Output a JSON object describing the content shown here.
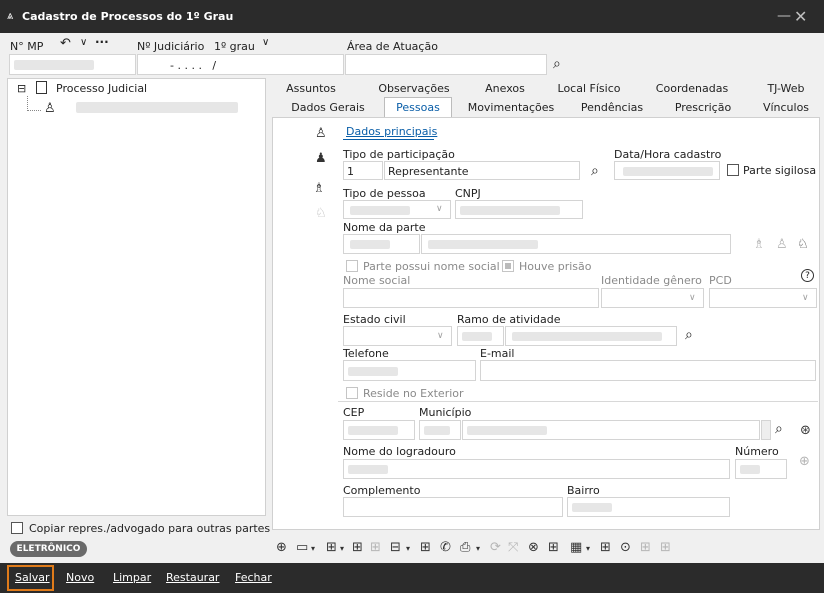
{
  "window": {
    "title": "Cadastro de Processos do 1º Grau",
    "minimize": "—",
    "close": "✕"
  },
  "header": {
    "mp_label": "N° MP",
    "undo_icon": "↶",
    "chevron": "∨",
    "more": "···",
    "judicial_label": "Nº Judiciário",
    "grau_label": "1º grau",
    "area_label": "Área de Atuação",
    "judicial_value": "- . . . .   /"
  },
  "tree": {
    "root": "Processo Judicial",
    "expander": "⊟"
  },
  "copiar": "Copiar repres./advogado para outras partes",
  "badge": "ELETRÔNICO",
  "tabs_row1": [
    "Assuntos",
    "Observações",
    "Anexos",
    "Local Físico",
    "Coordenadas",
    "TJ-Web"
  ],
  "tabs_row2": [
    "Dados Gerais",
    "Pessoas",
    "Movimentações",
    "Pendências",
    "Prescrição",
    "Vínculos"
  ],
  "form": {
    "subtab": "Dados principais",
    "tipo_participacao": "Tipo de participação",
    "tipo_code": "1",
    "tipo_value": "Representante",
    "data_hora": "Data/Hora cadastro",
    "parte_sigilosa": "Parte sigilosa",
    "tipo_pessoa": "Tipo de pessoa",
    "cnpj": "CNPJ",
    "nome_parte": "Nome da parte",
    "nome_social_chk": "Parte possui nome social",
    "houve_prisao": "Houve prisão",
    "nome_social": "Nome social",
    "identidade_genero": "Identidade gênero",
    "pcd": "PCD",
    "estado_civil": "Estado civil",
    "ramo_atividade": "Ramo de atividade",
    "telefone": "Telefone",
    "email": "E-mail",
    "reside_exterior": "Reside no Exterior",
    "cep": "CEP",
    "municipio": "Município",
    "nome_logradouro": "Nome do logradouro",
    "numero": "Número",
    "complemento": "Complemento",
    "bairro": "Bairro",
    "help": "?"
  },
  "toolbar_icons": [
    "⊕",
    "▭",
    "▾",
    "⊞",
    "▾",
    "⊞",
    "⊞",
    "⊟",
    "▾",
    "⊞",
    "✆",
    "⎙",
    "▾",
    "⟳",
    "⤧",
    "⊗",
    "⊞",
    "▦",
    "▾",
    "⊞",
    "⊙",
    "⊞",
    "⊞"
  ],
  "bottom": {
    "salvar": "Salvar",
    "novo": "Novo",
    "limpar": "Limpar",
    "restaurar": "Restaurar",
    "fechar": "Fechar"
  },
  "colors": {
    "accent": "#0a5ea8",
    "bar": "#2b2b2b",
    "highlight": "#e07b1a"
  }
}
